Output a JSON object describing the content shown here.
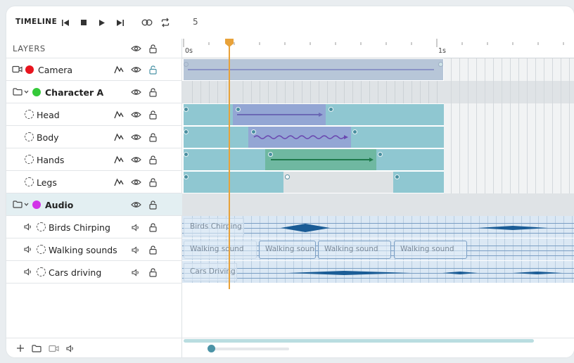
{
  "toolbar": {
    "title": "TIMELINE",
    "frame": "5",
    "icons": [
      "skip-back-icon",
      "stop-icon",
      "play-icon",
      "skip-forward-icon",
      "loop-toggle-icon",
      "repeat-icon"
    ]
  },
  "layers": {
    "header": "LAYERS",
    "rows": [
      {
        "name": "Camera",
        "color": "#e8141e",
        "kind": "camera"
      },
      {
        "name": "Character A",
        "color": "#35c93a",
        "kind": "group"
      },
      {
        "name": "Head",
        "kind": "child"
      },
      {
        "name": "Body",
        "kind": "child"
      },
      {
        "name": "Hands",
        "kind": "child"
      },
      {
        "name": "Legs",
        "kind": "child"
      },
      {
        "name": "Audio",
        "color": "#d233e8",
        "kind": "group",
        "selected": true
      },
      {
        "name": "Birds Chirping",
        "kind": "audio"
      },
      {
        "name": "Walking sounds",
        "kind": "audio"
      },
      {
        "name": "Cars driving",
        "kind": "audio"
      }
    ]
  },
  "ruler": {
    "labels": [
      "0s",
      "1s"
    ]
  },
  "clips": {
    "birds": "Birds Chirping",
    "walking": [
      "Walking sound",
      "Walking sound",
      "Walking sound",
      "Walking sound"
    ],
    "cars": "Cars Driving"
  },
  "colors": {
    "accent": "#4b93a6",
    "playhead": "#e8a23a",
    "keyframe_bar": "#8fc7d1",
    "camera_bar": "#b7c6d8"
  }
}
